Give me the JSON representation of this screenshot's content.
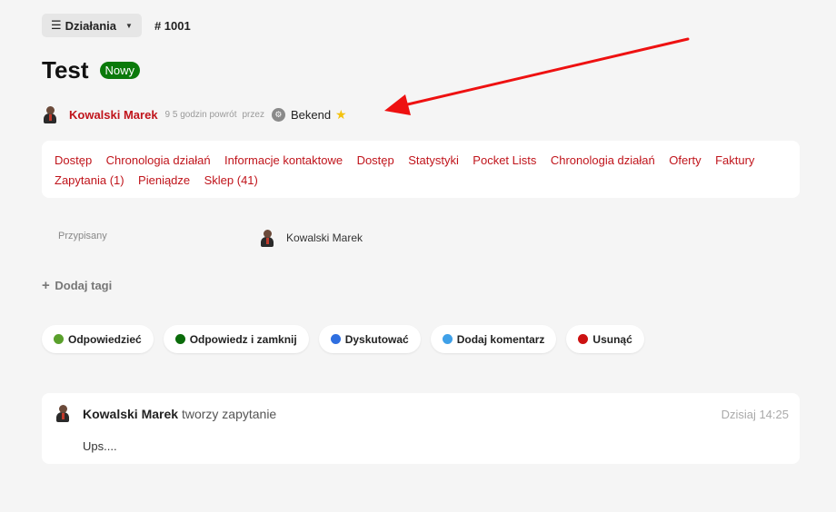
{
  "toolbar": {
    "actions_label": "Działania",
    "menu_icon": "hamburger-icon",
    "caret_icon": "caret-down-icon",
    "ticket_id": "# 1001"
  },
  "ticket": {
    "title": "Test",
    "status_badge": "Nowy",
    "status_color": "#0a7a0a"
  },
  "meta": {
    "author": "Kowalski Marek",
    "time": "9 5 godzin powrót",
    "via": "przez",
    "source": "Bekend",
    "star_icon": "star-icon"
  },
  "tabs": [
    {
      "label": "Dostęp"
    },
    {
      "label": "Chronologia działań"
    },
    {
      "label": "Informacje kontaktowe"
    },
    {
      "label": "Dostęp"
    },
    {
      "label": "Statystyki"
    },
    {
      "label": "Pocket Lists"
    },
    {
      "label": "Chronologia działań"
    },
    {
      "label": "Oferty"
    },
    {
      "label": "Faktury"
    },
    {
      "label": "Zapytania (1)"
    },
    {
      "label": "Pieniądze"
    },
    {
      "label": "Sklep (41)"
    }
  ],
  "assigned": {
    "label": "Przypisany",
    "name": "Kowalski Marek"
  },
  "tags": {
    "add_label": "Dodaj tagi"
  },
  "actions": [
    {
      "label": "Odpowiedzieć",
      "color": "#5aa02c"
    },
    {
      "label": "Odpowiedz i zamknij",
      "color": "#0a6b0a"
    },
    {
      "label": "Dyskutować",
      "color": "#2f6fe0"
    },
    {
      "label": "Dodaj komentarz",
      "color": "#3fa0e8"
    },
    {
      "label": "Usunąć",
      "color": "#cc1111"
    }
  ],
  "comment": {
    "author": "Kowalski Marek",
    "action": "tworzy zapytanie",
    "time": "Dzisiaj 14:25",
    "text": "Ups...."
  },
  "colors": {
    "link": "#c0141b",
    "arrow": "#ee1111",
    "star": "#f4c20d"
  }
}
